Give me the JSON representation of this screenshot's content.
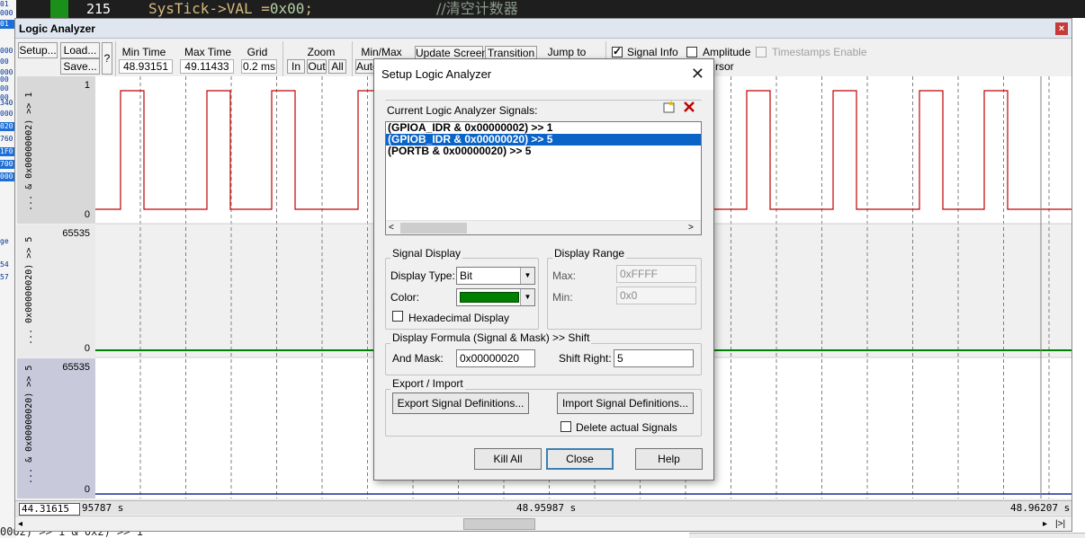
{
  "editor": {
    "line_number": "215",
    "code": "SysTick->VAL",
    "code_op": " =",
    "code_value": "0x00",
    "code_end": ";",
    "comment": "//清空计数器",
    "left_labels": [
      "01",
      "000",
      "01",
      "000",
      "00",
      "000",
      "00",
      "00",
      "00",
      "340",
      "000",
      "020",
      "760",
      "1F0",
      "700",
      "000"
    ],
    "left_ge": "ge",
    "left_54": "54",
    "left_57": "57",
    "bottom_code": "0002) >> 1 & 0x2) >> 1"
  },
  "logic_analyzer": {
    "title": "Logic Analyzer",
    "setup_label": "Setup...",
    "load_label": "Load...",
    "save_label": "Save...",
    "help_label": "?",
    "min_time_label": "Min Time",
    "min_time_value": "48.93151 s",
    "max_time_label": "Max Time",
    "max_time_value": "49.11433 s",
    "grid_label": "Grid",
    "grid_value": "0.2 ms",
    "zoom_label": "Zoom",
    "zoom_in": "In",
    "zoom_out": "Out",
    "zoom_all": "All",
    "minmax_label": "Min/Max",
    "minmax_auto": "Auto",
    "update_screen_label": "Update Screen",
    "transition_label": "Transition",
    "jump_to_label": "Jump to",
    "signal_info_label": "Signal Info",
    "amplitude_label": "Amplitude",
    "timestamps_label": "Timestamps Enable",
    "cursor_partial": "rsor",
    "channels": [
      {
        "name": "... & 0x00000002) >> 1",
        "max": "1",
        "min": "0"
      },
      {
        "name": "... 0x00000020) >> 5",
        "max": "65535",
        "min": "0"
      },
      {
        "name": "... & 0x00000020) >> 5",
        "max": "65535",
        "min": "0"
      }
    ],
    "time_left_box": "44.31615 s",
    "time_left": "95787 s",
    "time_center": "48.95987 s",
    "time_right": "48.96207 s",
    "scroll_left": "◂",
    "scroll_right": "▸",
    "scroll_end": "|>|",
    "colors": {
      "signal_bit": "#c00000",
      "signal_green": "#008000",
      "signal_blue": "#1a2a9a",
      "grid": "#808080"
    }
  },
  "dialog": {
    "title": "Setup Logic Analyzer",
    "close_icon": "✕",
    "current_signals_label": "Current Logic Analyzer Signals:",
    "new_icon": "new-signal-icon",
    "delete_icon": "delete-signal-icon",
    "signals": [
      "(GPIOA_IDR & 0x00000002) >> 1",
      "(GPIOB_IDR & 0x00000020) >> 5",
      "(PORTB & 0x00000020) >> 5"
    ],
    "selected_index": 1,
    "list_scroll_left": "<",
    "list_scroll_right": ">",
    "signal_display_title": "Signal Display",
    "display_type_label": "Display Type:",
    "display_type_value": "Bit",
    "color_label": "Color:",
    "signal_color": "#008000",
    "hex_display_label": "Hexadecimal Display",
    "display_range_title": "Display Range",
    "max_label": "Max:",
    "max_value": "0xFFFF",
    "min_label": "Min:",
    "min_value": "0x0",
    "formula_title": "Display Formula (Signal & Mask) >> Shift",
    "and_mask_label": "And Mask:",
    "and_mask_value": "0x00000020",
    "shift_right_label": "Shift Right:",
    "shift_right_value": "5",
    "export_import_title": "Export / Import",
    "export_label": "Export Signal Definitions...",
    "import_label": "Import Signal Definitions...",
    "delete_actual_label": "Delete actual Signals",
    "kill_all_label": "Kill All",
    "close_label": "Close",
    "help_label": "Help"
  }
}
